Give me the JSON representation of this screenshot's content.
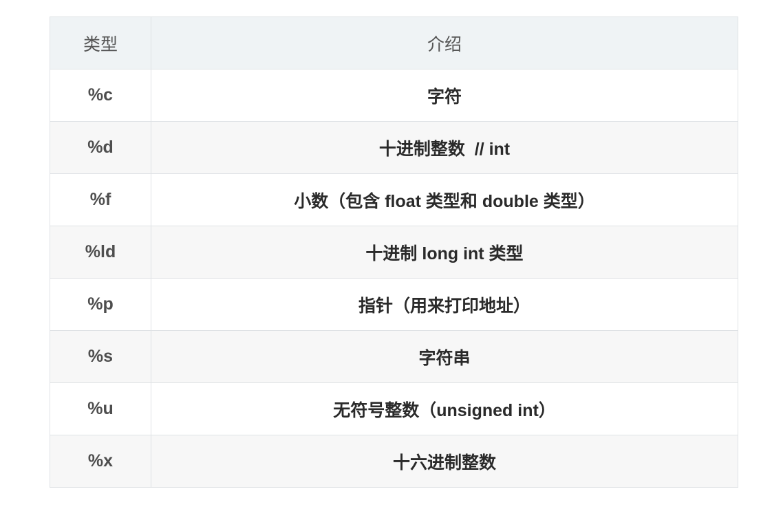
{
  "table": {
    "headers": {
      "type": "类型",
      "description": "介绍"
    },
    "rows": [
      {
        "type": "%c",
        "description": "字符"
      },
      {
        "type": "%d",
        "description": "十进制整数  // int"
      },
      {
        "type": "%f",
        "description": "小数（包含 float 类型和 double 类型）"
      },
      {
        "type": "%ld",
        "description": "十进制 long int 类型"
      },
      {
        "type": "%p",
        "description": "指针（用来打印地址）"
      },
      {
        "type": "%s",
        "description": "字符串"
      },
      {
        "type": "%u",
        "description": "无符号整数（unsigned int）"
      },
      {
        "type": "%x",
        "description": "十六进制整数"
      }
    ]
  }
}
